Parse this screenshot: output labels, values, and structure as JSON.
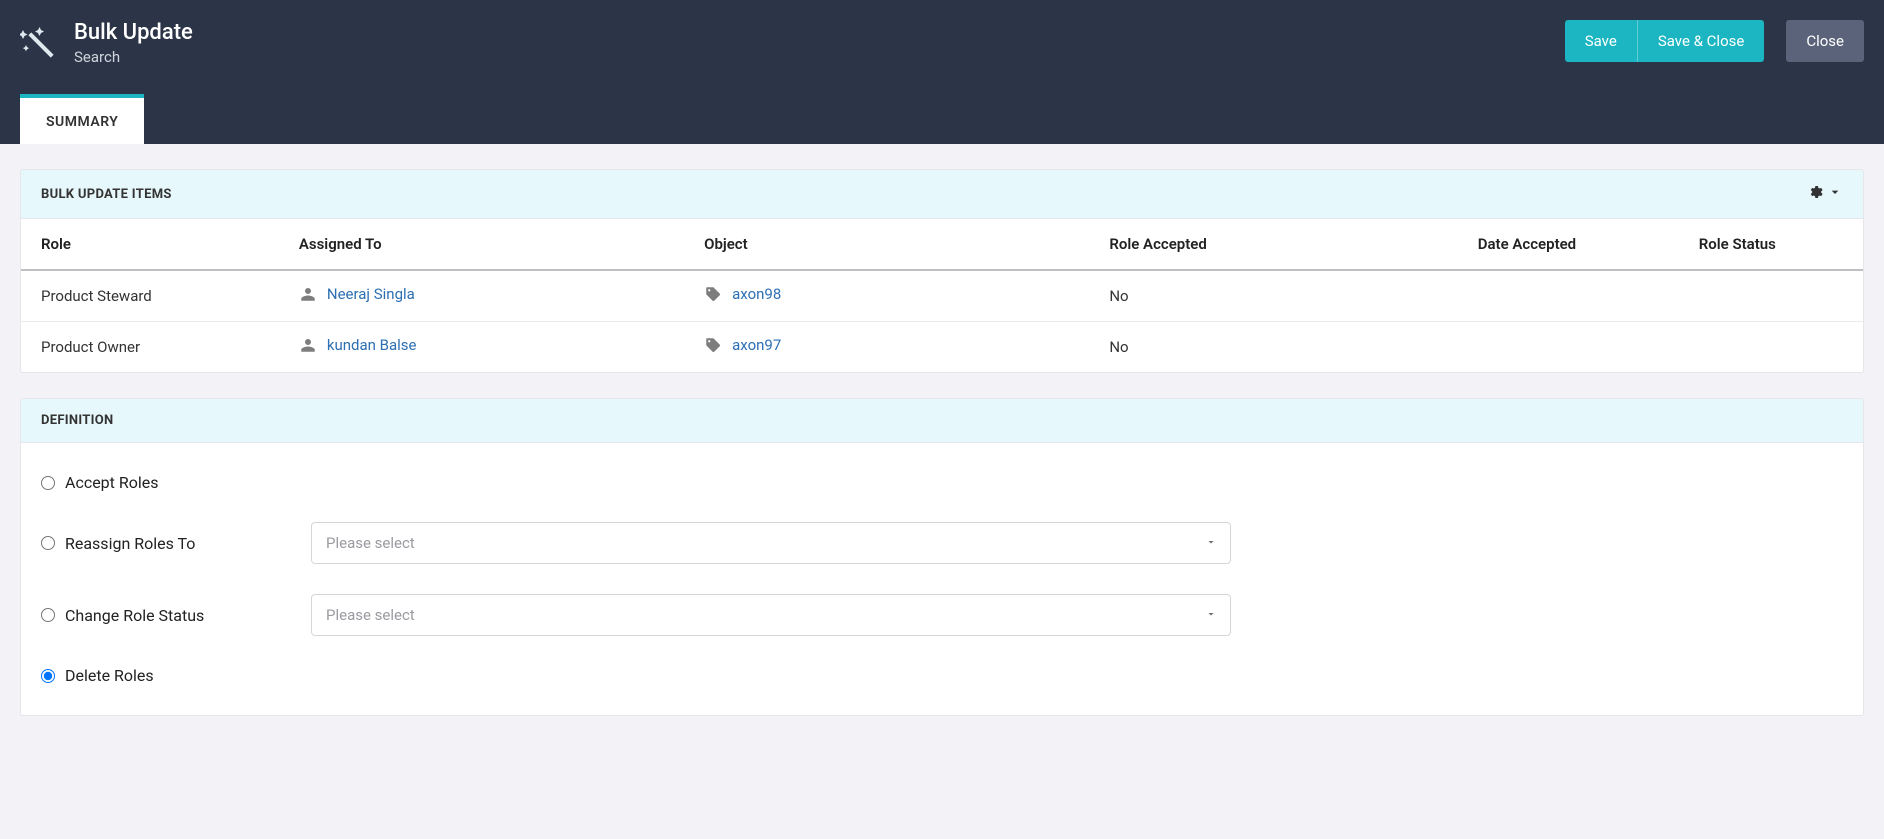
{
  "header": {
    "title": "Bulk Update",
    "subtitle": "Search",
    "buttons": {
      "save": "Save",
      "save_close": "Save & Close",
      "close": "Close"
    }
  },
  "tabs": {
    "summary": "SUMMARY"
  },
  "panel_items": {
    "title": "BULK UPDATE ITEMS",
    "columns": {
      "role": "Role",
      "assigned_to": "Assigned To",
      "object": "Object",
      "role_accepted": "Role Accepted",
      "date_accepted": "Date Accepted",
      "role_status": "Role Status"
    },
    "rows": [
      {
        "role": "Product Steward",
        "assigned_to": "Neeraj Singla",
        "object": "axon98",
        "role_accepted": "No",
        "date_accepted": "",
        "role_status": ""
      },
      {
        "role": "Product Owner",
        "assigned_to": "kundan Balse",
        "object": "axon97",
        "role_accepted": "No",
        "date_accepted": "",
        "role_status": ""
      }
    ]
  },
  "panel_definition": {
    "title": "DEFINITION",
    "options": {
      "accept": "Accept Roles",
      "reassign": "Reassign Roles To",
      "change_status": "Change Role Status",
      "delete": "Delete Roles"
    },
    "select_placeholder": "Please select",
    "selected": "delete"
  },
  "icons": {
    "wand": "wand-icon",
    "gear": "gear-icon",
    "chevron_down": "chevron-down-icon",
    "person": "person-icon",
    "tag": "tag-icon"
  }
}
